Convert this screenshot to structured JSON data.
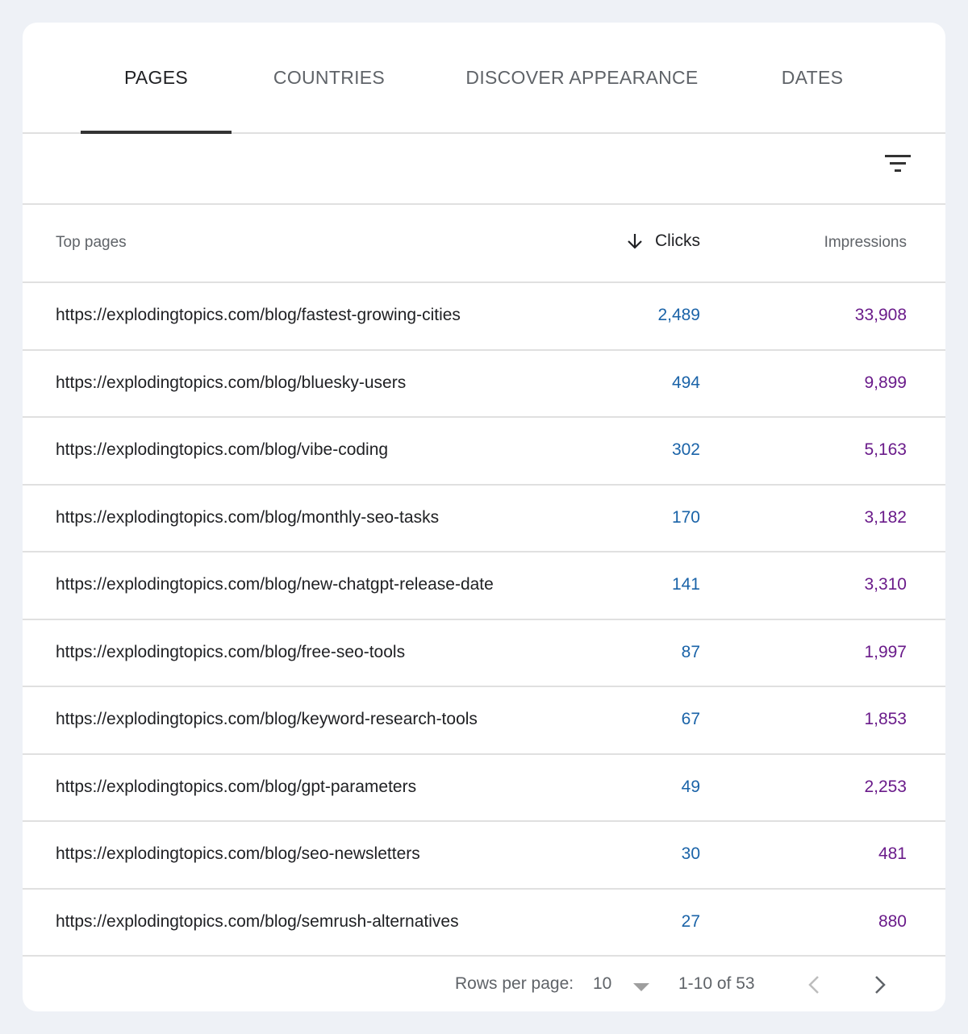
{
  "tabs": [
    {
      "label": "PAGES",
      "active": true
    },
    {
      "label": "COUNTRIES",
      "active": false
    },
    {
      "label": "DISCOVER APPEARANCE",
      "active": false
    },
    {
      "label": "DATES",
      "active": false
    }
  ],
  "filter": {
    "icon": "filter-icon"
  },
  "table": {
    "headers": {
      "page": "Top pages",
      "clicks": "Clicks",
      "impressions": "Impressions"
    },
    "sort": {
      "column": "clicks",
      "direction": "descending",
      "icon": "arrow-down-icon"
    },
    "rows": [
      {
        "page": "https://explodingtopics.com/blog/fastest-growing-cities",
        "clicks": "2,489",
        "impressions": "33,908"
      },
      {
        "page": "https://explodingtopics.com/blog/bluesky-users",
        "clicks": "494",
        "impressions": "9,899"
      },
      {
        "page": "https://explodingtopics.com/blog/vibe-coding",
        "clicks": "302",
        "impressions": "5,163"
      },
      {
        "page": "https://explodingtopics.com/blog/monthly-seo-tasks",
        "clicks": "170",
        "impressions": "3,182"
      },
      {
        "page": "https://explodingtopics.com/blog/new-chatgpt-release-date",
        "clicks": "141",
        "impressions": "3,310"
      },
      {
        "page": "https://explodingtopics.com/blog/free-seo-tools",
        "clicks": "87",
        "impressions": "1,997"
      },
      {
        "page": "https://explodingtopics.com/blog/keyword-research-tools",
        "clicks": "67",
        "impressions": "1,853"
      },
      {
        "page": "https://explodingtopics.com/blog/gpt-parameters",
        "clicks": "49",
        "impressions": "2,253"
      },
      {
        "page": "https://explodingtopics.com/blog/seo-newsletters",
        "clicks": "30",
        "impressions": "481"
      },
      {
        "page": "https://explodingtopics.com/blog/semrush-alternatives",
        "clicks": "27",
        "impressions": "880"
      }
    ]
  },
  "pagination": {
    "rows_per_page_label": "Rows per page:",
    "rows_per_page": "10",
    "range": "1-10 of 53"
  },
  "colors": {
    "clicks": "#1a63a8",
    "impressions": "#6a1b8a",
    "active_tab": "#202124"
  }
}
